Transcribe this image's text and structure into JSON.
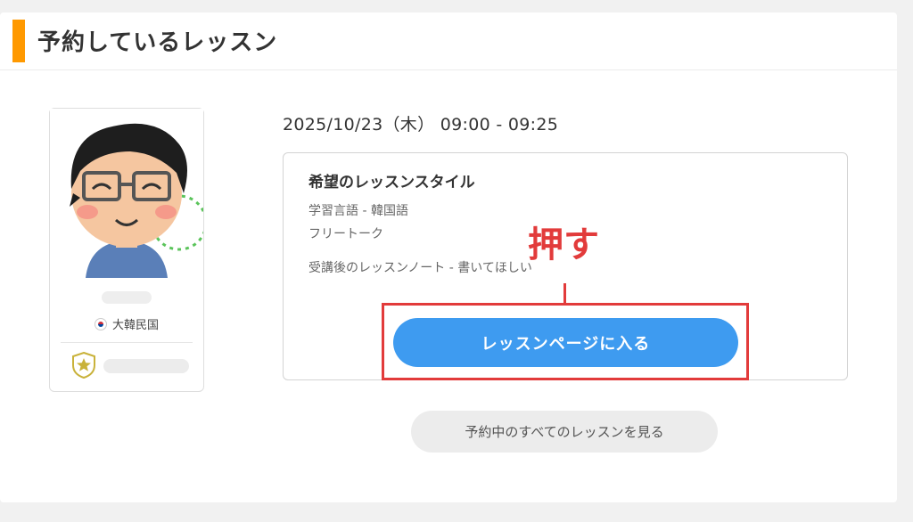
{
  "header": {
    "title": "予約しているレッスン"
  },
  "tutor": {
    "country": "大韓民国"
  },
  "lesson": {
    "datetime": "2025/10/23（木） 09:00 - 09:25",
    "style_title": "希望のレッスンスタイル",
    "language": "学習言語 - 韓国語",
    "mode": "フリートーク",
    "note": "受講後のレッスンノート - 書いてほしい",
    "enter_button": "レッスンページに入る"
  },
  "annotation": {
    "label": "押す"
  },
  "all_lessons_button": "予約中のすべてのレッスンを見る",
  "colors": {
    "accent": "#ff9900",
    "button": "#3e9bf0",
    "annotation": "#e23b3b"
  }
}
